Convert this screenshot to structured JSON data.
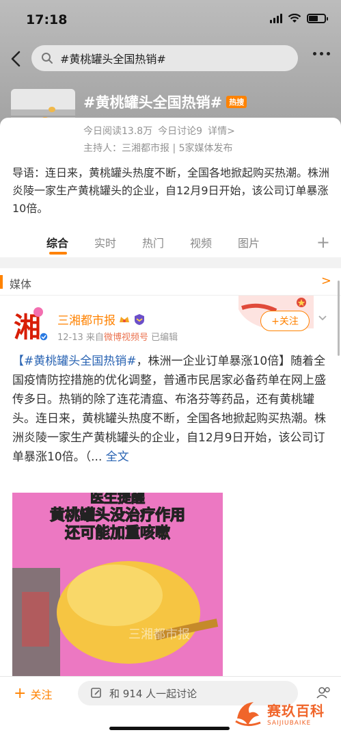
{
  "status_bar": {
    "time": "17:18"
  },
  "search": {
    "query": "#黄桃罐头全国热销#"
  },
  "topic": {
    "title": "#黄桃罐头全国热销#",
    "hot_badge": "热搜",
    "reads": "今日阅读13.8万",
    "discussions": "今日讨论9",
    "details": "详情>",
    "host": "主持人：三湘都市报 | 5家媒体发布",
    "intro": "导语：连日来，黄桃罐头热度不断，全国各地掀起购买热潮。株洲炎陵一家生产黄桃罐头的企业，自12月9日开始，该公司订单暴涨10倍。"
  },
  "tabs": [
    {
      "label": "综合"
    },
    {
      "label": "实时"
    },
    {
      "label": "热门"
    },
    {
      "label": "视频"
    },
    {
      "label": "图片"
    }
  ],
  "tab_plus": "+",
  "media_section": {
    "label": "媒体",
    "arrow": ">"
  },
  "post": {
    "author": "三湘都市报",
    "avatar_char": "湘",
    "date": "12-13",
    "source_prefix": "来自",
    "source": "微博视频号",
    "edited": "已编辑",
    "follow_label": "+关注",
    "hashtag": "【#黄桃罐头全国热销#",
    "headline": "，株洲一企业订单暴涨10倍】",
    "body": "随着全国疫情防控措施的优化调整，普通市民居家必备药单在网上盛传多日。热销的除了连花清瘟、布洛芬等药品，还有黄桃罐头。连日来，黄桃罐头热度不断，全国各地掀起购买热潮。株洲炎陵一家生产黄桃罐头的企业，自12月9日开始，该公司订单暴涨10倍。（...",
    "full_text": "全文",
    "video_caption_1": "医生提醒",
    "video_caption_2": "黄桃罐头没治疗作用",
    "video_caption_3": "还可能加重咳嗽",
    "video_watermark": "三湘都市报"
  },
  "bottom_bar": {
    "follow_label": "关注",
    "follow_plus": "+",
    "comment_placeholder": "和 914 人一起讨论"
  },
  "watermark": {
    "main": "赛玖百科",
    "sub": "SAIJIUBAIKE"
  },
  "colors": {
    "accent": "#ff8200",
    "link": "#2a64b3"
  }
}
